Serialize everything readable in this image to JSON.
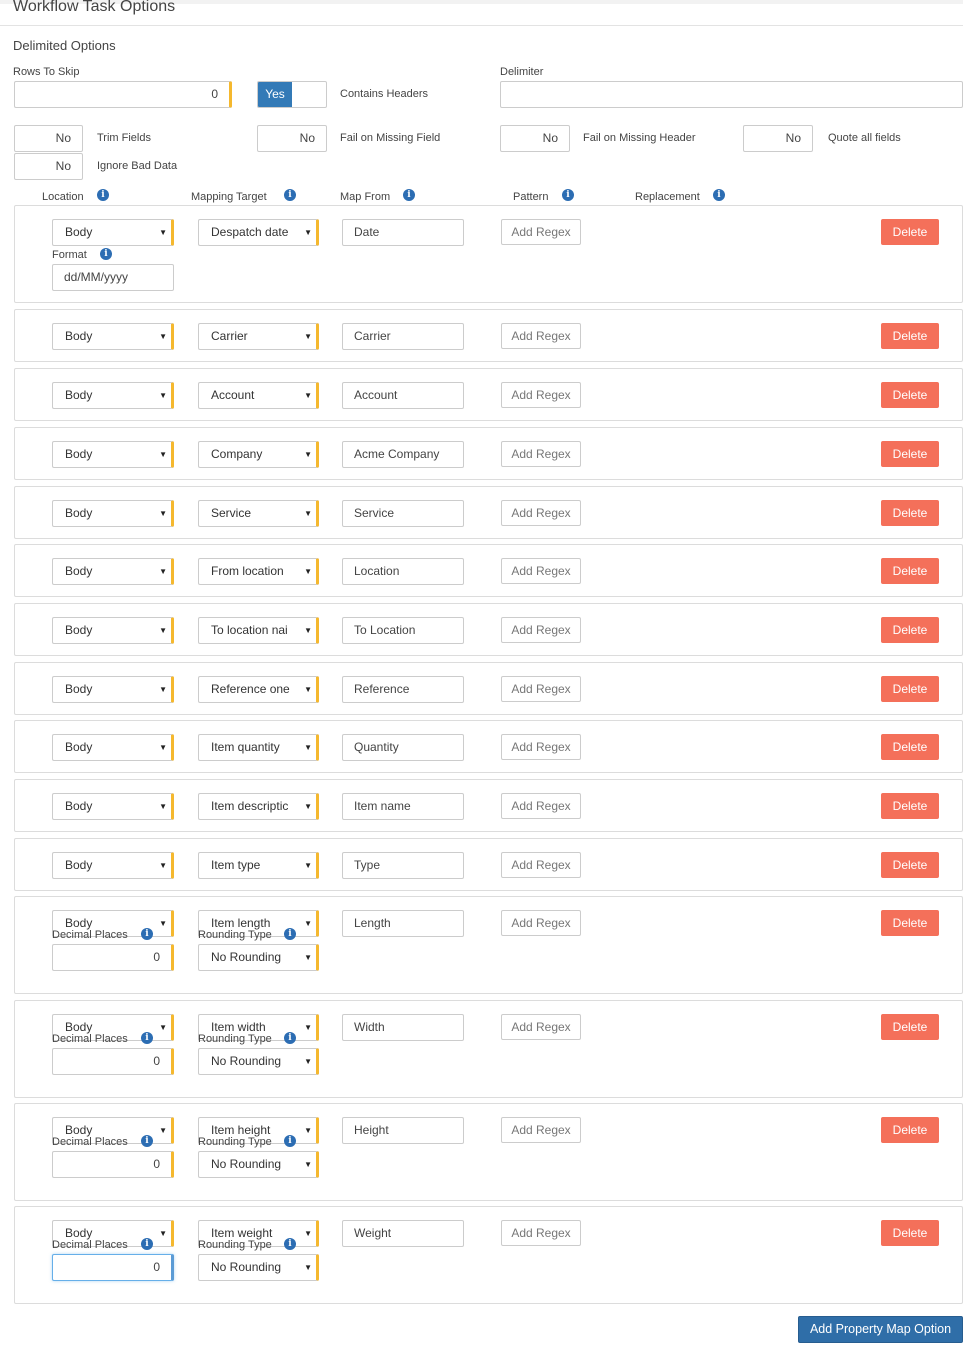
{
  "page": {
    "title": "Workflow Task Options",
    "section_title": "Delimited Options"
  },
  "options": {
    "rows_to_skip_label": "Rows To Skip",
    "rows_to_skip_value": "0",
    "contains_headers_toggle": "Yes",
    "contains_headers_label": "Contains Headers",
    "delimiter_label": "Delimiter",
    "delimiter_value": "",
    "trim_fields_value": "No",
    "trim_fields_label": "Trim Fields",
    "fail_missing_field_value": "No",
    "fail_missing_field_label": "Fail on Missing Field",
    "fail_missing_header_value": "No",
    "fail_missing_header_label": "Fail on Missing Header",
    "quote_all_value": "No",
    "quote_all_label": "Quote all fields",
    "ignore_bad_data_value": "No",
    "ignore_bad_data_label": "Ignore Bad Data"
  },
  "columns": {
    "location": "Location",
    "mapping_target": "Mapping Target",
    "map_from": "Map From",
    "pattern": "Pattern",
    "replacement": "Replacement"
  },
  "row_labels": {
    "format": "Format",
    "decimal_places": "Decimal Places",
    "rounding_type": "Rounding Type",
    "add_regex": "Add Regex",
    "delete": "Delete"
  },
  "mappings": [
    {
      "location": "Body",
      "target": "Despatch date",
      "from": "Date",
      "format": "dd/MM/yyyy"
    },
    {
      "location": "Body",
      "target": "Carrier",
      "from": "Carrier"
    },
    {
      "location": "Body",
      "target": "Account",
      "from": "Account"
    },
    {
      "location": "Body",
      "target": "Company",
      "from": "Acme Company"
    },
    {
      "location": "Body",
      "target": "Service",
      "from": "Service"
    },
    {
      "location": "Body",
      "target": "From location",
      "from": "Location"
    },
    {
      "location": "Body",
      "target": "To location nai",
      "from": "To Location"
    },
    {
      "location": "Body",
      "target": "Reference one",
      "from": "Reference"
    },
    {
      "location": "Body",
      "target": "Item quantity",
      "from": "Quantity"
    },
    {
      "location": "Body",
      "target": "Item descriptic",
      "from": "Item name"
    },
    {
      "location": "Body",
      "target": "Item type",
      "from": "Type"
    },
    {
      "location": "Body",
      "target": "Item length",
      "from": "Length",
      "decimal_places": "0",
      "rounding": "No Rounding"
    },
    {
      "location": "Body",
      "target": "Item width",
      "from": "Width",
      "decimal_places": "0",
      "rounding": "No Rounding"
    },
    {
      "location": "Body",
      "target": "Item height",
      "from": "Height",
      "decimal_places": "0",
      "rounding": "No Rounding"
    },
    {
      "location": "Body",
      "target": "Item weight",
      "from": "Weight",
      "decimal_places": "0",
      "rounding": "No Rounding"
    }
  ],
  "footer": {
    "add_button": "Add Property Map Option"
  },
  "icons": {
    "info": "info-icon",
    "dropdown": "caret-down-icon"
  },
  "colors": {
    "primary": "#337ab7",
    "danger": "#f4705a",
    "accent": "#f5b82e",
    "info": "#2c6db3"
  }
}
